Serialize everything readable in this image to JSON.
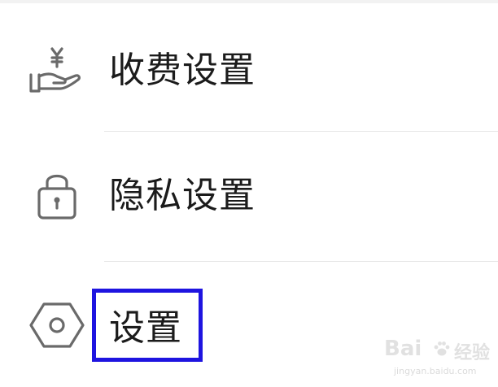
{
  "menu": {
    "items": [
      {
        "label": "收费设置",
        "icon": "hand-yuan-icon"
      },
      {
        "label": "隐私设置",
        "icon": "lock-icon"
      },
      {
        "label": "设置",
        "icon": "hexagon-gear-icon",
        "highlighted": true
      }
    ]
  },
  "annotation": {
    "highlight_color": "#1e14e0"
  },
  "watermark": {
    "brand": "Bai",
    "name": "经验",
    "url": "jingyan.baidu.com"
  },
  "colors": {
    "text": "#1b1b1b",
    "icon": "#6a6a6a",
    "divider": "#e6e6e6",
    "background": "#ffffff"
  }
}
